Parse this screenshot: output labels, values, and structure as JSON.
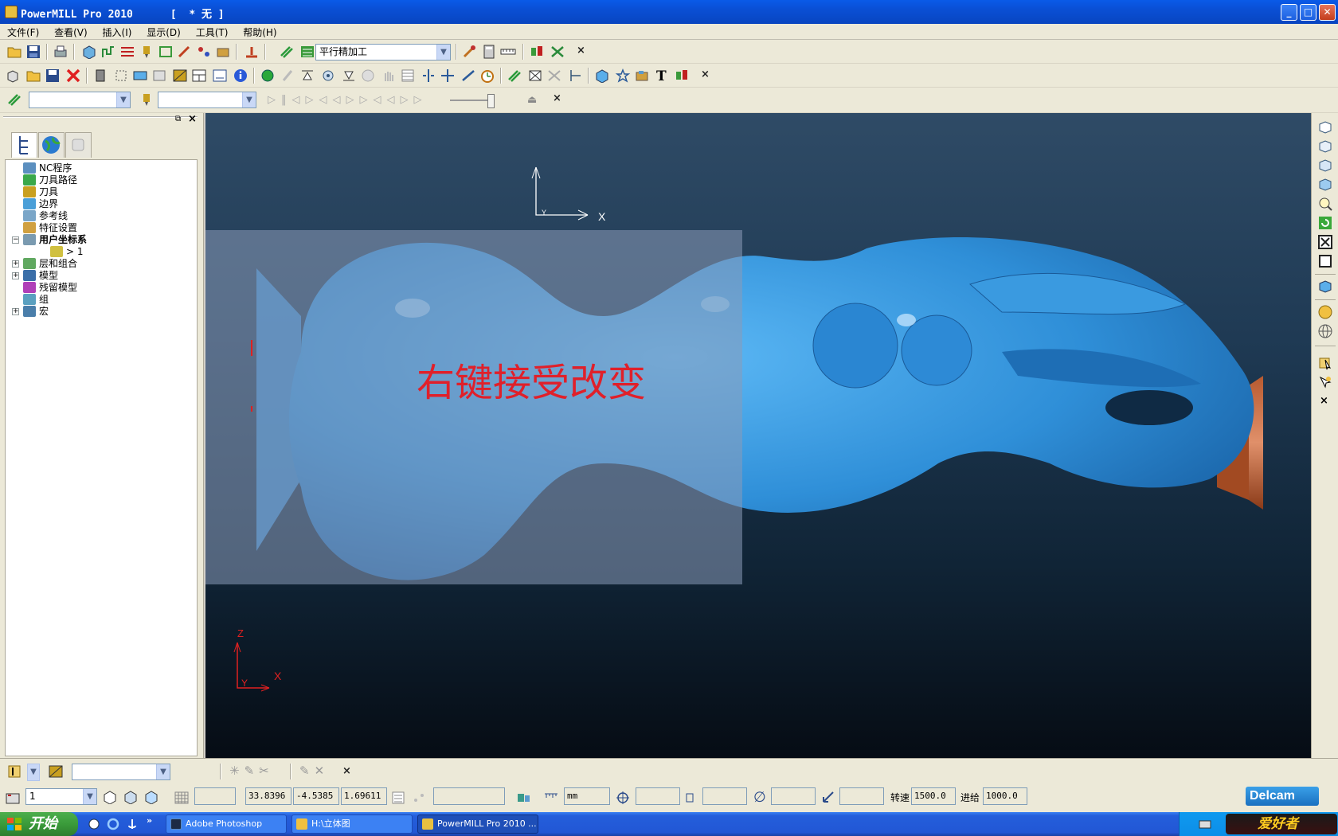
{
  "window": {
    "title": "PowerMILL Pro 2010      [  * 无 ]",
    "minimize": "_",
    "maximize": "□",
    "close": "✕"
  },
  "menu": [
    "文件(F)",
    "查看(V)",
    "插入(I)",
    "显示(D)",
    "工具(T)",
    "帮助(H)"
  ],
  "toolbar1": {
    "strategy_combo": "平行精加工"
  },
  "toolbar3": {
    "combo1": "",
    "combo2": ""
  },
  "tree": {
    "items": [
      {
        "label": "NC程序",
        "icon_color": "#5b8fbf"
      },
      {
        "label": "刀具路径",
        "icon_color": "#3aa84a"
      },
      {
        "label": "刀具",
        "icon_color": "#c9a020"
      },
      {
        "label": "边界",
        "icon_color": "#4a9fd8"
      },
      {
        "label": "参考线",
        "icon_color": "#7aa6c8"
      },
      {
        "label": "特征设置",
        "icon_color": "#d0a040"
      },
      {
        "label": "用户坐标系",
        "icon_color": "#7a9ab0"
      },
      {
        "label": "> 1",
        "icon_color": "#d0c040"
      },
      {
        "label": "层和组合",
        "icon_color": "#60a860"
      },
      {
        "label": "模型",
        "icon_color": "#3a6ea8"
      },
      {
        "label": "残留模型",
        "icon_color": "#b040b8"
      },
      {
        "label": "组",
        "icon_color": "#5aa0c0"
      },
      {
        "label": "宏",
        "icon_color": "#4a7eaa"
      }
    ]
  },
  "viewport": {
    "overlay_text": "右键接受改变",
    "axis_top_x": "X",
    "axis_top_y": "Y",
    "axis_bottom_z": "Z",
    "axis_bottom_x": "X",
    "axis_bottom_y": "Y",
    "model_color": "#3a96dc",
    "overlay_text_color": "#e0202a"
  },
  "statusbar": {
    "layer_value": "1",
    "coord_x": "33.8396",
    "coord_y": "-4.5385",
    "coord_z": "1.69611",
    "units": "mm",
    "speed_label": "转速",
    "speed_value": "1500.0",
    "feed_label": "进给",
    "feed_value": "1000.0",
    "brand": "Delcam"
  },
  "taskbar": {
    "start": "开始",
    "tasks": [
      {
        "label": "Adobe Photoshop",
        "active": false
      },
      {
        "label": "H:\\立体图",
        "active": false
      },
      {
        "label": "PowerMILL Pro 2010 ...",
        "active": true
      }
    ],
    "watermark": "爱好者"
  }
}
